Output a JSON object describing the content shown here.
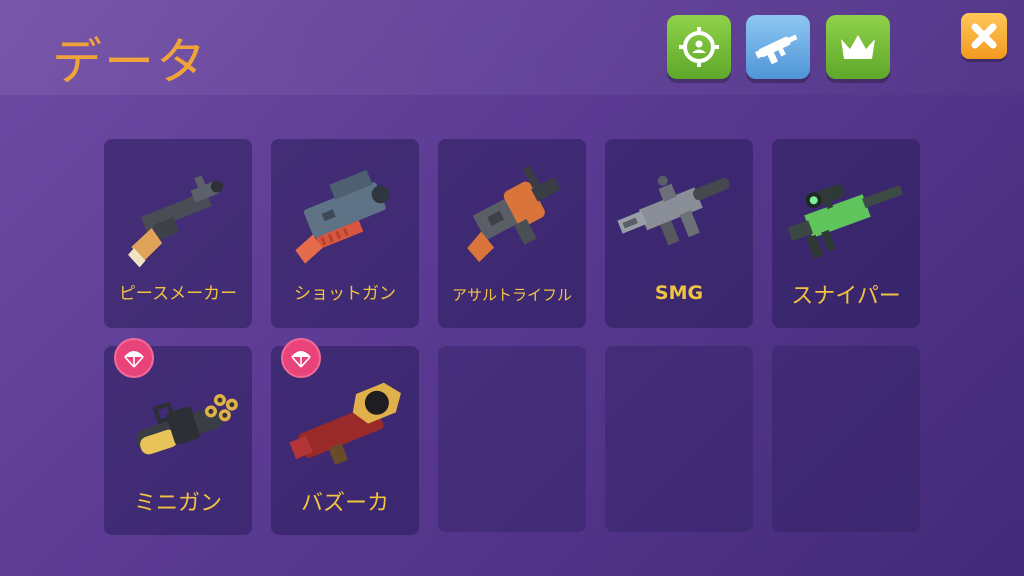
{
  "header": {
    "title": "データ",
    "buttons": [
      {
        "name": "target-button",
        "icon": "crosshair-person-icon",
        "color": "#6fbb35"
      },
      {
        "name": "weapon-button",
        "icon": "gun-icon",
        "color": "#5ea2e0"
      },
      {
        "name": "crown-button",
        "icon": "crown-icon",
        "color": "#6fbb35"
      }
    ],
    "close_icon": "close-icon"
  },
  "weapons": [
    {
      "label": "ピースメーカー",
      "icon": "pistol-icon",
      "airdrop": false
    },
    {
      "label": "ショットガン",
      "icon": "shotgun-icon",
      "airdrop": false
    },
    {
      "label": "アサルトライフル",
      "icon": "assault-rifle-icon",
      "airdrop": false
    },
    {
      "label": "SMG",
      "icon": "smg-icon",
      "airdrop": false
    },
    {
      "label": "スナイパー",
      "icon": "sniper-icon",
      "airdrop": false
    },
    {
      "label": "ミニガン",
      "icon": "minigun-icon",
      "airdrop": true
    },
    {
      "label": "バズーカ",
      "icon": "bazooka-icon",
      "airdrop": true
    }
  ],
  "colors": {
    "title": "#f0a33a",
    "label": "#f1c342",
    "airdrop_badge": "#e8447a"
  }
}
